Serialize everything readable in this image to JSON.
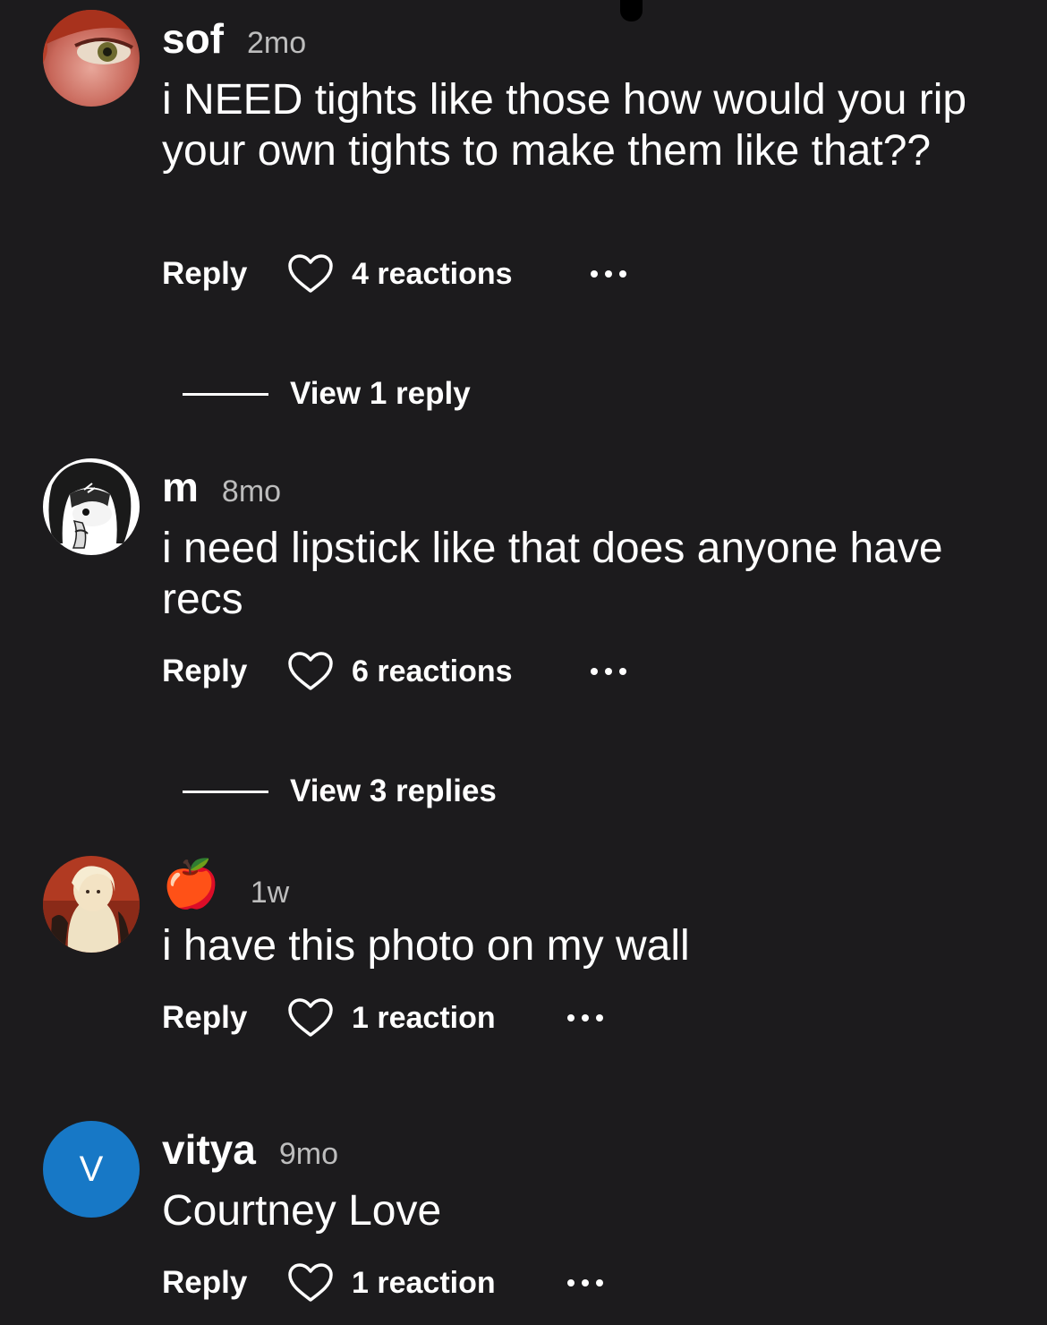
{
  "comments": [
    {
      "username": "sof",
      "time": "2mo",
      "text": "i NEED tights like those how would you rip your own tights to make them like that??",
      "reply_label": "Reply",
      "reactions": "4 reactions",
      "view_replies": "View 1 reply"
    },
    {
      "username": "m",
      "time": "8mo",
      "text": "i need lipstick like that does anyone have recs",
      "reply_label": "Reply",
      "reactions": "6 reactions",
      "view_replies": "View 3 replies"
    },
    {
      "username": "🍎",
      "time": "1w",
      "text": "i have this photo on my wall",
      "reply_label": "Reply",
      "reactions": "1 reaction"
    },
    {
      "username": "vitya",
      "avatar_letter": "V",
      "avatar_color": "#1778c6",
      "time": "9mo",
      "text": "Courtney Love",
      "reply_label": "Reply",
      "reactions": "1 reaction"
    }
  ],
  "colors": {
    "background": "#1c1b1d",
    "text": "#ffffff",
    "muted": "#bdbdbd"
  }
}
